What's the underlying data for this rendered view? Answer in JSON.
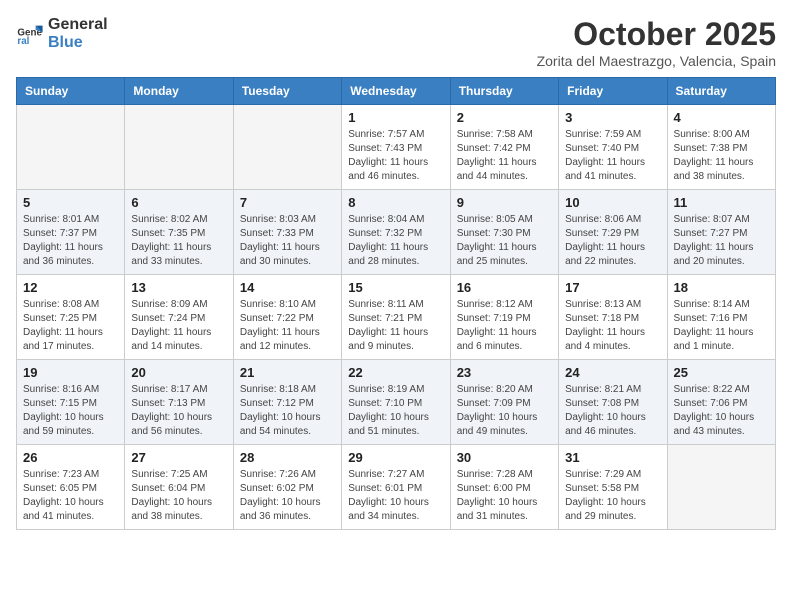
{
  "header": {
    "logo_line1": "General",
    "logo_line2": "Blue",
    "month": "October 2025",
    "location": "Zorita del Maestrazgo, Valencia, Spain"
  },
  "weekdays": [
    "Sunday",
    "Monday",
    "Tuesday",
    "Wednesday",
    "Thursday",
    "Friday",
    "Saturday"
  ],
  "weeks": [
    [
      {
        "day": "",
        "info": ""
      },
      {
        "day": "",
        "info": ""
      },
      {
        "day": "",
        "info": ""
      },
      {
        "day": "1",
        "info": "Sunrise: 7:57 AM\nSunset: 7:43 PM\nDaylight: 11 hours\nand 46 minutes."
      },
      {
        "day": "2",
        "info": "Sunrise: 7:58 AM\nSunset: 7:42 PM\nDaylight: 11 hours\nand 44 minutes."
      },
      {
        "day": "3",
        "info": "Sunrise: 7:59 AM\nSunset: 7:40 PM\nDaylight: 11 hours\nand 41 minutes."
      },
      {
        "day": "4",
        "info": "Sunrise: 8:00 AM\nSunset: 7:38 PM\nDaylight: 11 hours\nand 38 minutes."
      }
    ],
    [
      {
        "day": "5",
        "info": "Sunrise: 8:01 AM\nSunset: 7:37 PM\nDaylight: 11 hours\nand 36 minutes."
      },
      {
        "day": "6",
        "info": "Sunrise: 8:02 AM\nSunset: 7:35 PM\nDaylight: 11 hours\nand 33 minutes."
      },
      {
        "day": "7",
        "info": "Sunrise: 8:03 AM\nSunset: 7:33 PM\nDaylight: 11 hours\nand 30 minutes."
      },
      {
        "day": "8",
        "info": "Sunrise: 8:04 AM\nSunset: 7:32 PM\nDaylight: 11 hours\nand 28 minutes."
      },
      {
        "day": "9",
        "info": "Sunrise: 8:05 AM\nSunset: 7:30 PM\nDaylight: 11 hours\nand 25 minutes."
      },
      {
        "day": "10",
        "info": "Sunrise: 8:06 AM\nSunset: 7:29 PM\nDaylight: 11 hours\nand 22 minutes."
      },
      {
        "day": "11",
        "info": "Sunrise: 8:07 AM\nSunset: 7:27 PM\nDaylight: 11 hours\nand 20 minutes."
      }
    ],
    [
      {
        "day": "12",
        "info": "Sunrise: 8:08 AM\nSunset: 7:25 PM\nDaylight: 11 hours\nand 17 minutes."
      },
      {
        "day": "13",
        "info": "Sunrise: 8:09 AM\nSunset: 7:24 PM\nDaylight: 11 hours\nand 14 minutes."
      },
      {
        "day": "14",
        "info": "Sunrise: 8:10 AM\nSunset: 7:22 PM\nDaylight: 11 hours\nand 12 minutes."
      },
      {
        "day": "15",
        "info": "Sunrise: 8:11 AM\nSunset: 7:21 PM\nDaylight: 11 hours\nand 9 minutes."
      },
      {
        "day": "16",
        "info": "Sunrise: 8:12 AM\nSunset: 7:19 PM\nDaylight: 11 hours\nand 6 minutes."
      },
      {
        "day": "17",
        "info": "Sunrise: 8:13 AM\nSunset: 7:18 PM\nDaylight: 11 hours\nand 4 minutes."
      },
      {
        "day": "18",
        "info": "Sunrise: 8:14 AM\nSunset: 7:16 PM\nDaylight: 11 hours\nand 1 minute."
      }
    ],
    [
      {
        "day": "19",
        "info": "Sunrise: 8:16 AM\nSunset: 7:15 PM\nDaylight: 10 hours\nand 59 minutes."
      },
      {
        "day": "20",
        "info": "Sunrise: 8:17 AM\nSunset: 7:13 PM\nDaylight: 10 hours\nand 56 minutes."
      },
      {
        "day": "21",
        "info": "Sunrise: 8:18 AM\nSunset: 7:12 PM\nDaylight: 10 hours\nand 54 minutes."
      },
      {
        "day": "22",
        "info": "Sunrise: 8:19 AM\nSunset: 7:10 PM\nDaylight: 10 hours\nand 51 minutes."
      },
      {
        "day": "23",
        "info": "Sunrise: 8:20 AM\nSunset: 7:09 PM\nDaylight: 10 hours\nand 49 minutes."
      },
      {
        "day": "24",
        "info": "Sunrise: 8:21 AM\nSunset: 7:08 PM\nDaylight: 10 hours\nand 46 minutes."
      },
      {
        "day": "25",
        "info": "Sunrise: 8:22 AM\nSunset: 7:06 PM\nDaylight: 10 hours\nand 43 minutes."
      }
    ],
    [
      {
        "day": "26",
        "info": "Sunrise: 7:23 AM\nSunset: 6:05 PM\nDaylight: 10 hours\nand 41 minutes."
      },
      {
        "day": "27",
        "info": "Sunrise: 7:25 AM\nSunset: 6:04 PM\nDaylight: 10 hours\nand 38 minutes."
      },
      {
        "day": "28",
        "info": "Sunrise: 7:26 AM\nSunset: 6:02 PM\nDaylight: 10 hours\nand 36 minutes."
      },
      {
        "day": "29",
        "info": "Sunrise: 7:27 AM\nSunset: 6:01 PM\nDaylight: 10 hours\nand 34 minutes."
      },
      {
        "day": "30",
        "info": "Sunrise: 7:28 AM\nSunset: 6:00 PM\nDaylight: 10 hours\nand 31 minutes."
      },
      {
        "day": "31",
        "info": "Sunrise: 7:29 AM\nSunset: 5:58 PM\nDaylight: 10 hours\nand 29 minutes."
      },
      {
        "day": "",
        "info": ""
      }
    ]
  ]
}
